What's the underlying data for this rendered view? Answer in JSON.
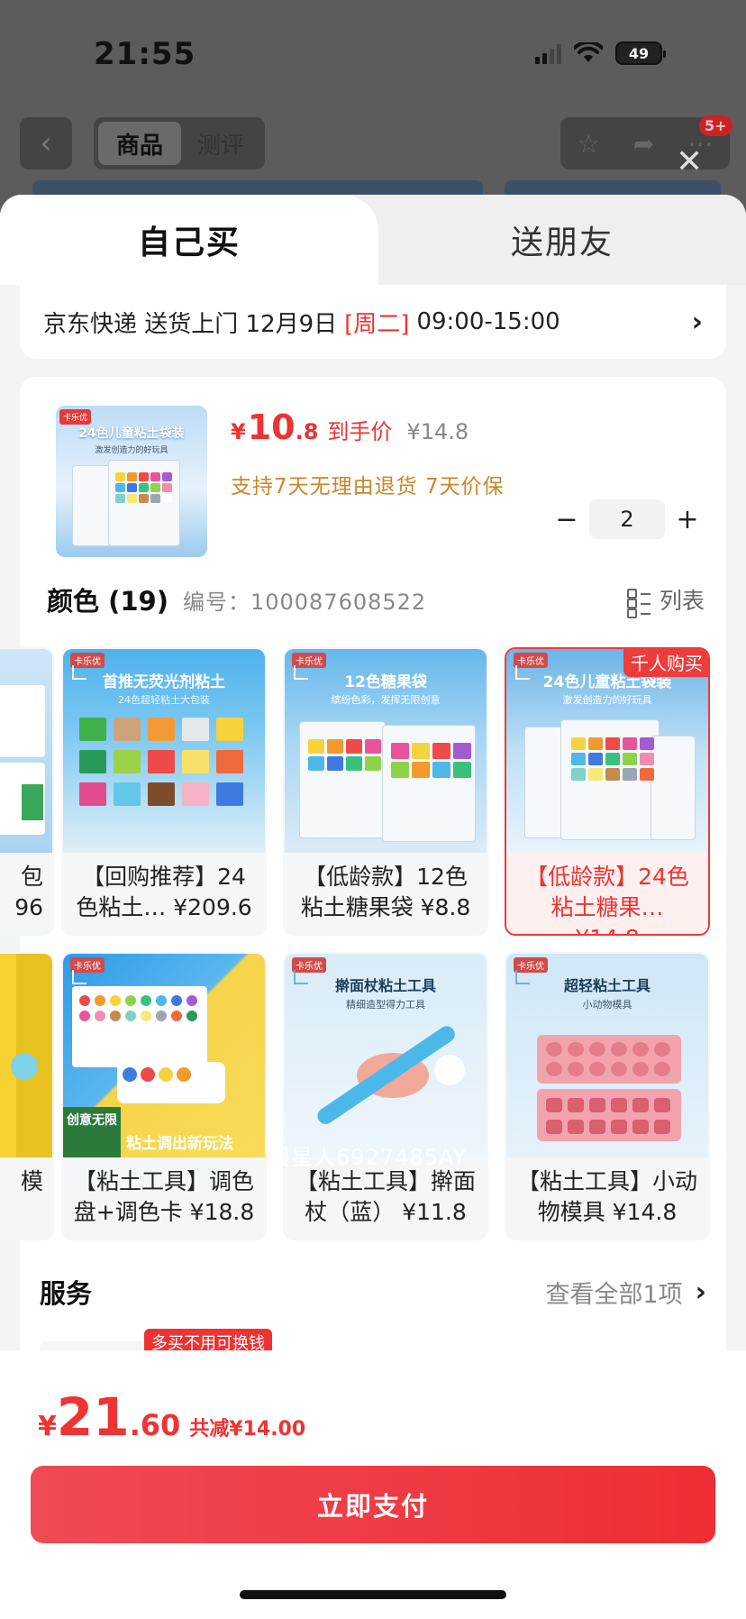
{
  "status_bar": {
    "time": "21:55",
    "battery": "49"
  },
  "bg_header": {
    "tabs": [
      "商品",
      "测评"
    ],
    "badge": "5+"
  },
  "sheet": {
    "tabs": {
      "self": "自己买",
      "gift": "送朋友"
    },
    "delivery": {
      "prefix": "京东快递 送货上门 12月9日",
      "weekday": "[周二]",
      "time": "09:00-15:00"
    },
    "product": {
      "thumb_tag": "卡乐优",
      "thumb_title": "24色儿童粘土袋装",
      "thumb_sub": "激发创造力的好玩具",
      "price_symbol": "¥",
      "price_int": "10",
      "price_dec": ".8",
      "price_label": "到手价",
      "original_price": "¥14.8",
      "guarantee": "支持7天无理由退货   7天价保",
      "quantity": "2",
      "minus": "−",
      "plus": "+"
    },
    "color_section": {
      "title": "颜色 (19)",
      "sku": "编号：100087608522",
      "list_label": "列表"
    },
    "variants_row1": [
      {
        "caption": "包\n96",
        "title": "",
        "sub": ""
      },
      {
        "caption": "【回购推荐】24色粘土… ¥209.6",
        "title": "首推无荧光剂粘土",
        "sub": "24色超轻粘土大包装",
        "tag": "卡乐优"
      },
      {
        "caption": "【低龄款】12色粘土糖果袋 ¥8.8",
        "title": "12色糖果袋",
        "sub": "缤纷色彩，发挥无限创意",
        "tag": "卡乐优"
      },
      {
        "caption": "【低龄款】24色粘土糖果… ¥14.8",
        "title": "24色儿童粘土袋装",
        "sub": "激发创造力的好玩具",
        "tag": "卡乐优",
        "badge": "千人购买"
      }
    ],
    "variants_row2": [
      {
        "caption": "模"
      },
      {
        "caption": "【粘土工具】调色盘+调色卡 ¥18.8",
        "tag": "卡乐优",
        "slogan1": "创意无限",
        "slogan2": "粘土调出新玩法"
      },
      {
        "caption": "【粘土工具】擀面杖（蓝） ¥11.8",
        "title": "擀面杖粘土工具",
        "sub": "精细造型得力工具",
        "tag": "卡乐优"
      },
      {
        "caption": "【粘土工具】小动物模具 ¥14.8",
        "title": "超轻粘土工具",
        "sub": "小动物模具",
        "tag": "卡乐优"
      }
    ],
    "watermark": "慢星人6927485AY",
    "services": {
      "title": "服务",
      "more": "查看全部1项",
      "badge": "多买不用可换钱"
    }
  },
  "footer": {
    "symbol": "¥",
    "total_int": "21",
    "total_dec": ".60",
    "saving": "共减¥14.00",
    "pay_button": "立即支付"
  }
}
